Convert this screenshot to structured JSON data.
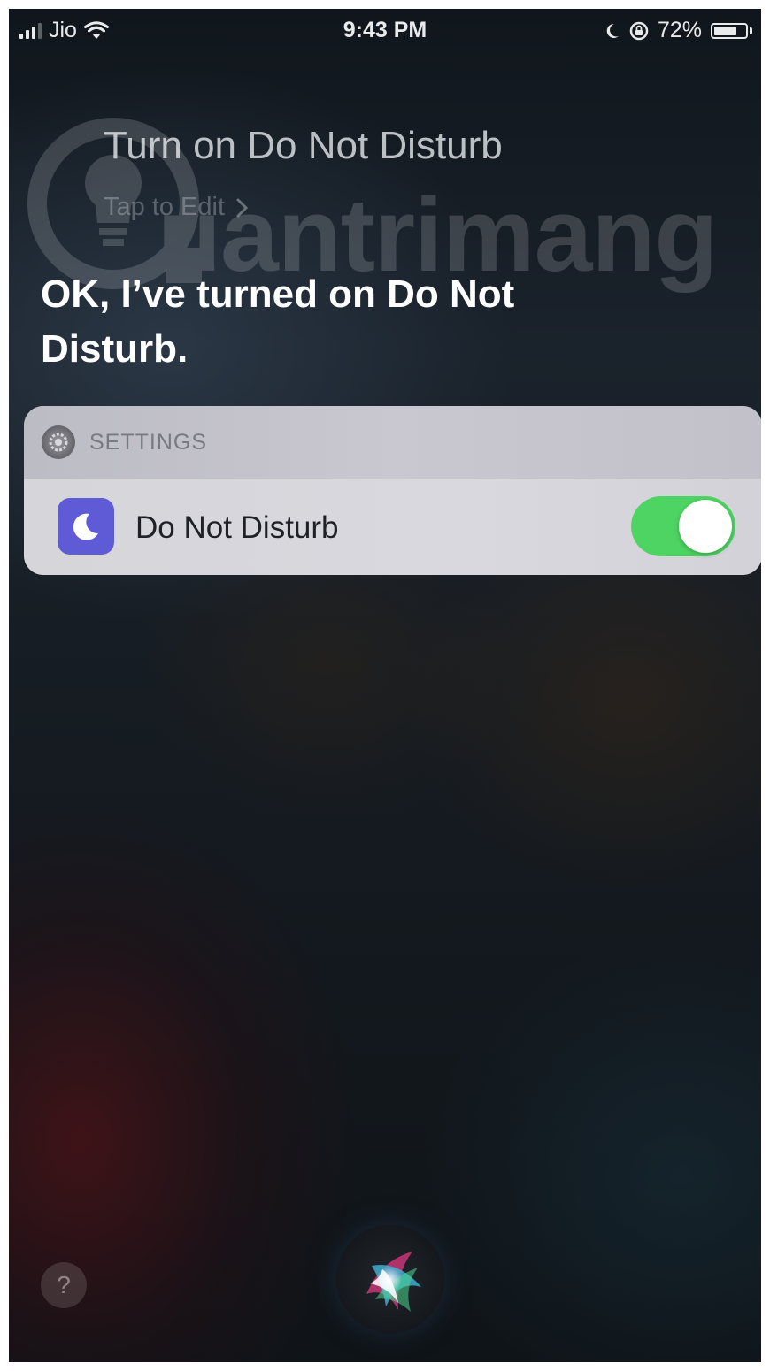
{
  "status_bar": {
    "carrier": "Jio",
    "time": "9:43 PM",
    "battery_percent": "72%",
    "battery_level": 0.72,
    "icons": [
      "signal-icon",
      "wifi-icon",
      "moon-icon",
      "orientation-lock-icon",
      "battery-icon"
    ]
  },
  "watermark": {
    "text": "uantrimang"
  },
  "siri": {
    "query": "Turn on Do Not Disturb",
    "tap_to_edit": "Tap to Edit",
    "response": "OK, I’ve turned on Do Not Disturb."
  },
  "card": {
    "app_name": "SETTINGS",
    "row_label": "Do Not Disturb",
    "toggle_on": true,
    "toggle_color": "#4ed463",
    "icon_color": "#5f5bd6"
  },
  "bottom": {
    "help_label": "?"
  }
}
